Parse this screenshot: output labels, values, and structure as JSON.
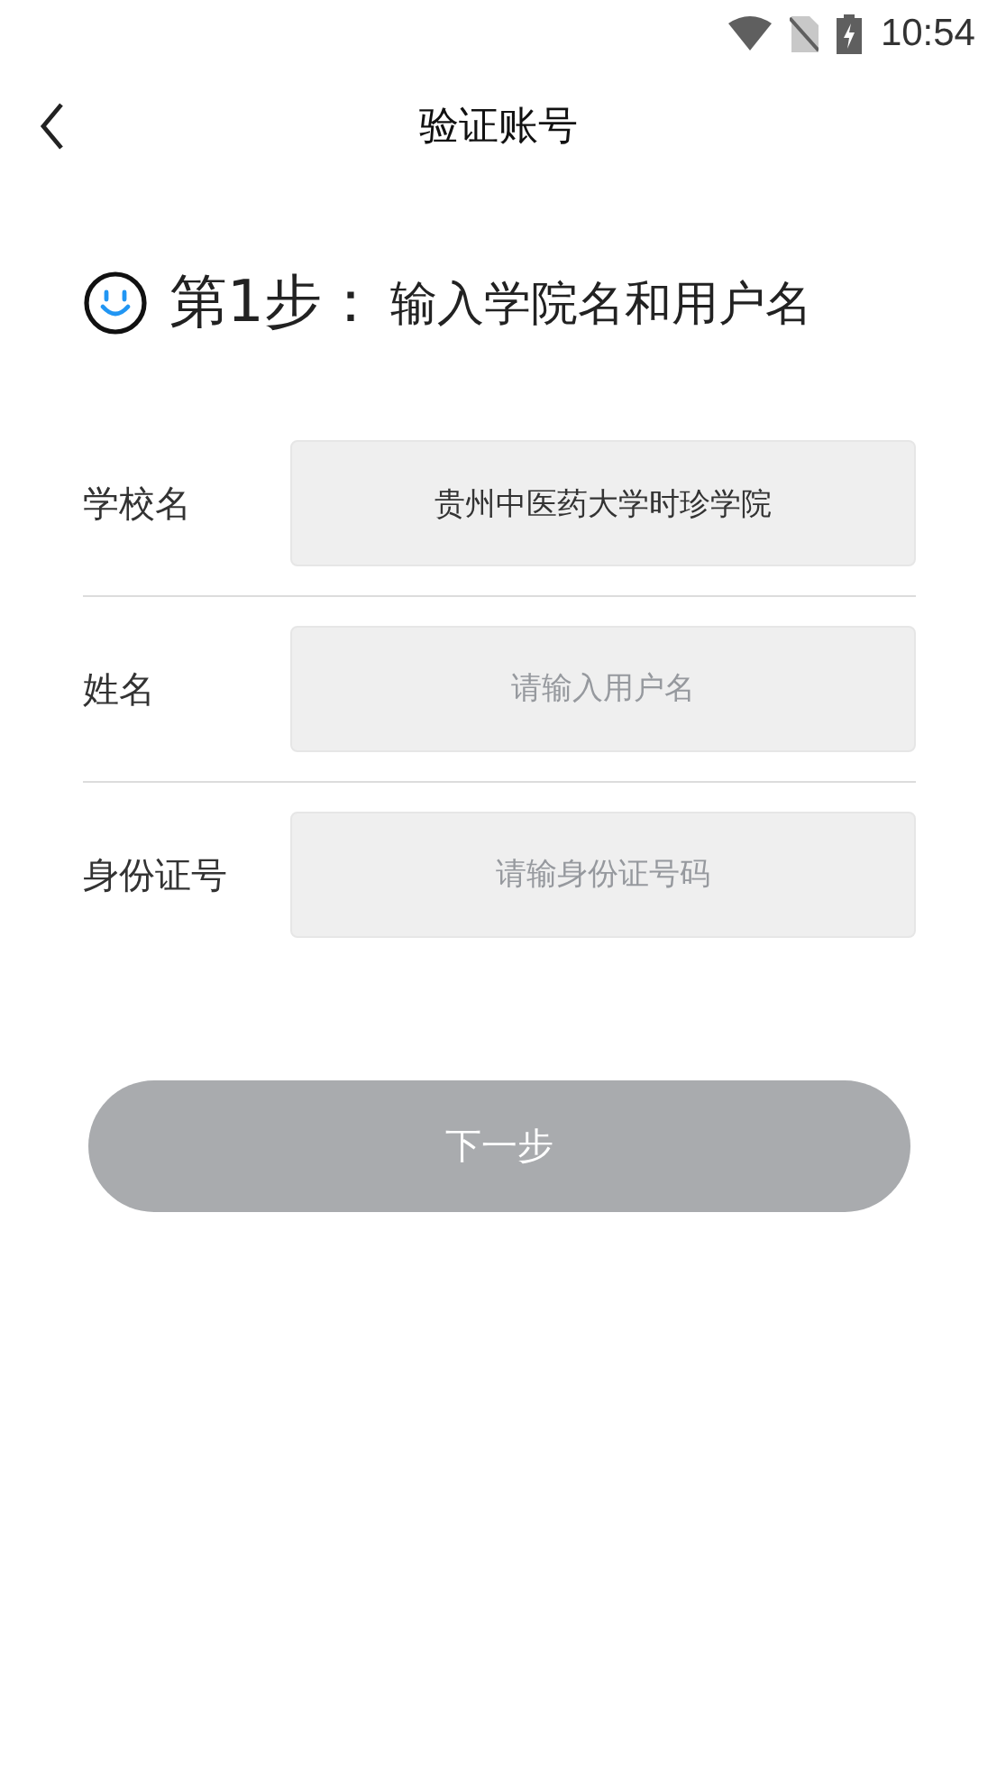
{
  "status_bar": {
    "time": "10:54"
  },
  "header": {
    "title": "验证账号"
  },
  "step": {
    "number": "第1步：",
    "text": "输入学院名和用户名"
  },
  "fields": [
    {
      "label": "学校名",
      "value": "贵州中医药大学时珍学院"
    },
    {
      "label": "姓名",
      "placeholder": "请输入用户名"
    },
    {
      "label": "身份证号",
      "placeholder": "请输身份证号码"
    }
  ],
  "next_button": {
    "label": "下一步",
    "disabled": true
  }
}
